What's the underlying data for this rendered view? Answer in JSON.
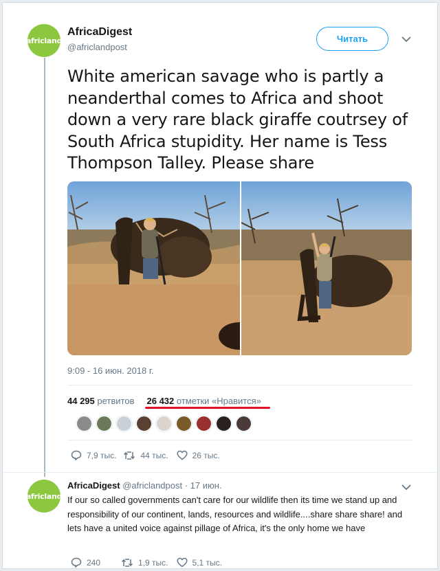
{
  "account": {
    "avatar_text": "africland",
    "name": "AfricaDigest",
    "handle": "@africlandpost"
  },
  "follow_button": "Читать",
  "tweet": {
    "text": "White american savage who is partly a neanderthal comes to Africa and shoot down a very rare black giraffe coutrsey of South Africa stupidity. Her name is Tess Thompson Talley. Please share",
    "timestamp": "9:09 - 16 июн. 2018 г.",
    "retweets_count": "44 295",
    "retweets_label": "ретвитов",
    "likes_count": "26 432",
    "likes_label": "отметки «Нравится»",
    "actions": {
      "replies": "7,9 тыс.",
      "retweets": "44 тыс.",
      "likes": "26 тыс."
    }
  },
  "liker_colors": [
    "#8a8a8a",
    "#6b7b5a",
    "#c8d0d8",
    "#5a4030",
    "#d9d4cc",
    "#7b5a2a",
    "#9b3030",
    "#2a2020",
    "#4a3a3a"
  ],
  "reply": {
    "name": "AfricaDigest",
    "handle": "@africlandpost",
    "time": "· 17 июн.",
    "text": "If our so called governments can't care for our wildlife then its time we stand up and responsibility of our continent, lands, resources and wildlife....share share share! and lets have a united voice against pillage of Africa, it's the only home we have",
    "actions": {
      "replies": "240",
      "retweets": "1,9 тыс.",
      "likes": "5,1 тыс."
    }
  },
  "colors": {
    "accent": "#1da1f2",
    "avatar_bg": "#8dc63f",
    "underline": "#e0102a",
    "muted": "#657786"
  },
  "media": [
    {
      "description_icon": "photo-hunter-kneeling-with-giraffe"
    },
    {
      "description_icon": "photo-hunter-standing-with-giraffe"
    }
  ]
}
